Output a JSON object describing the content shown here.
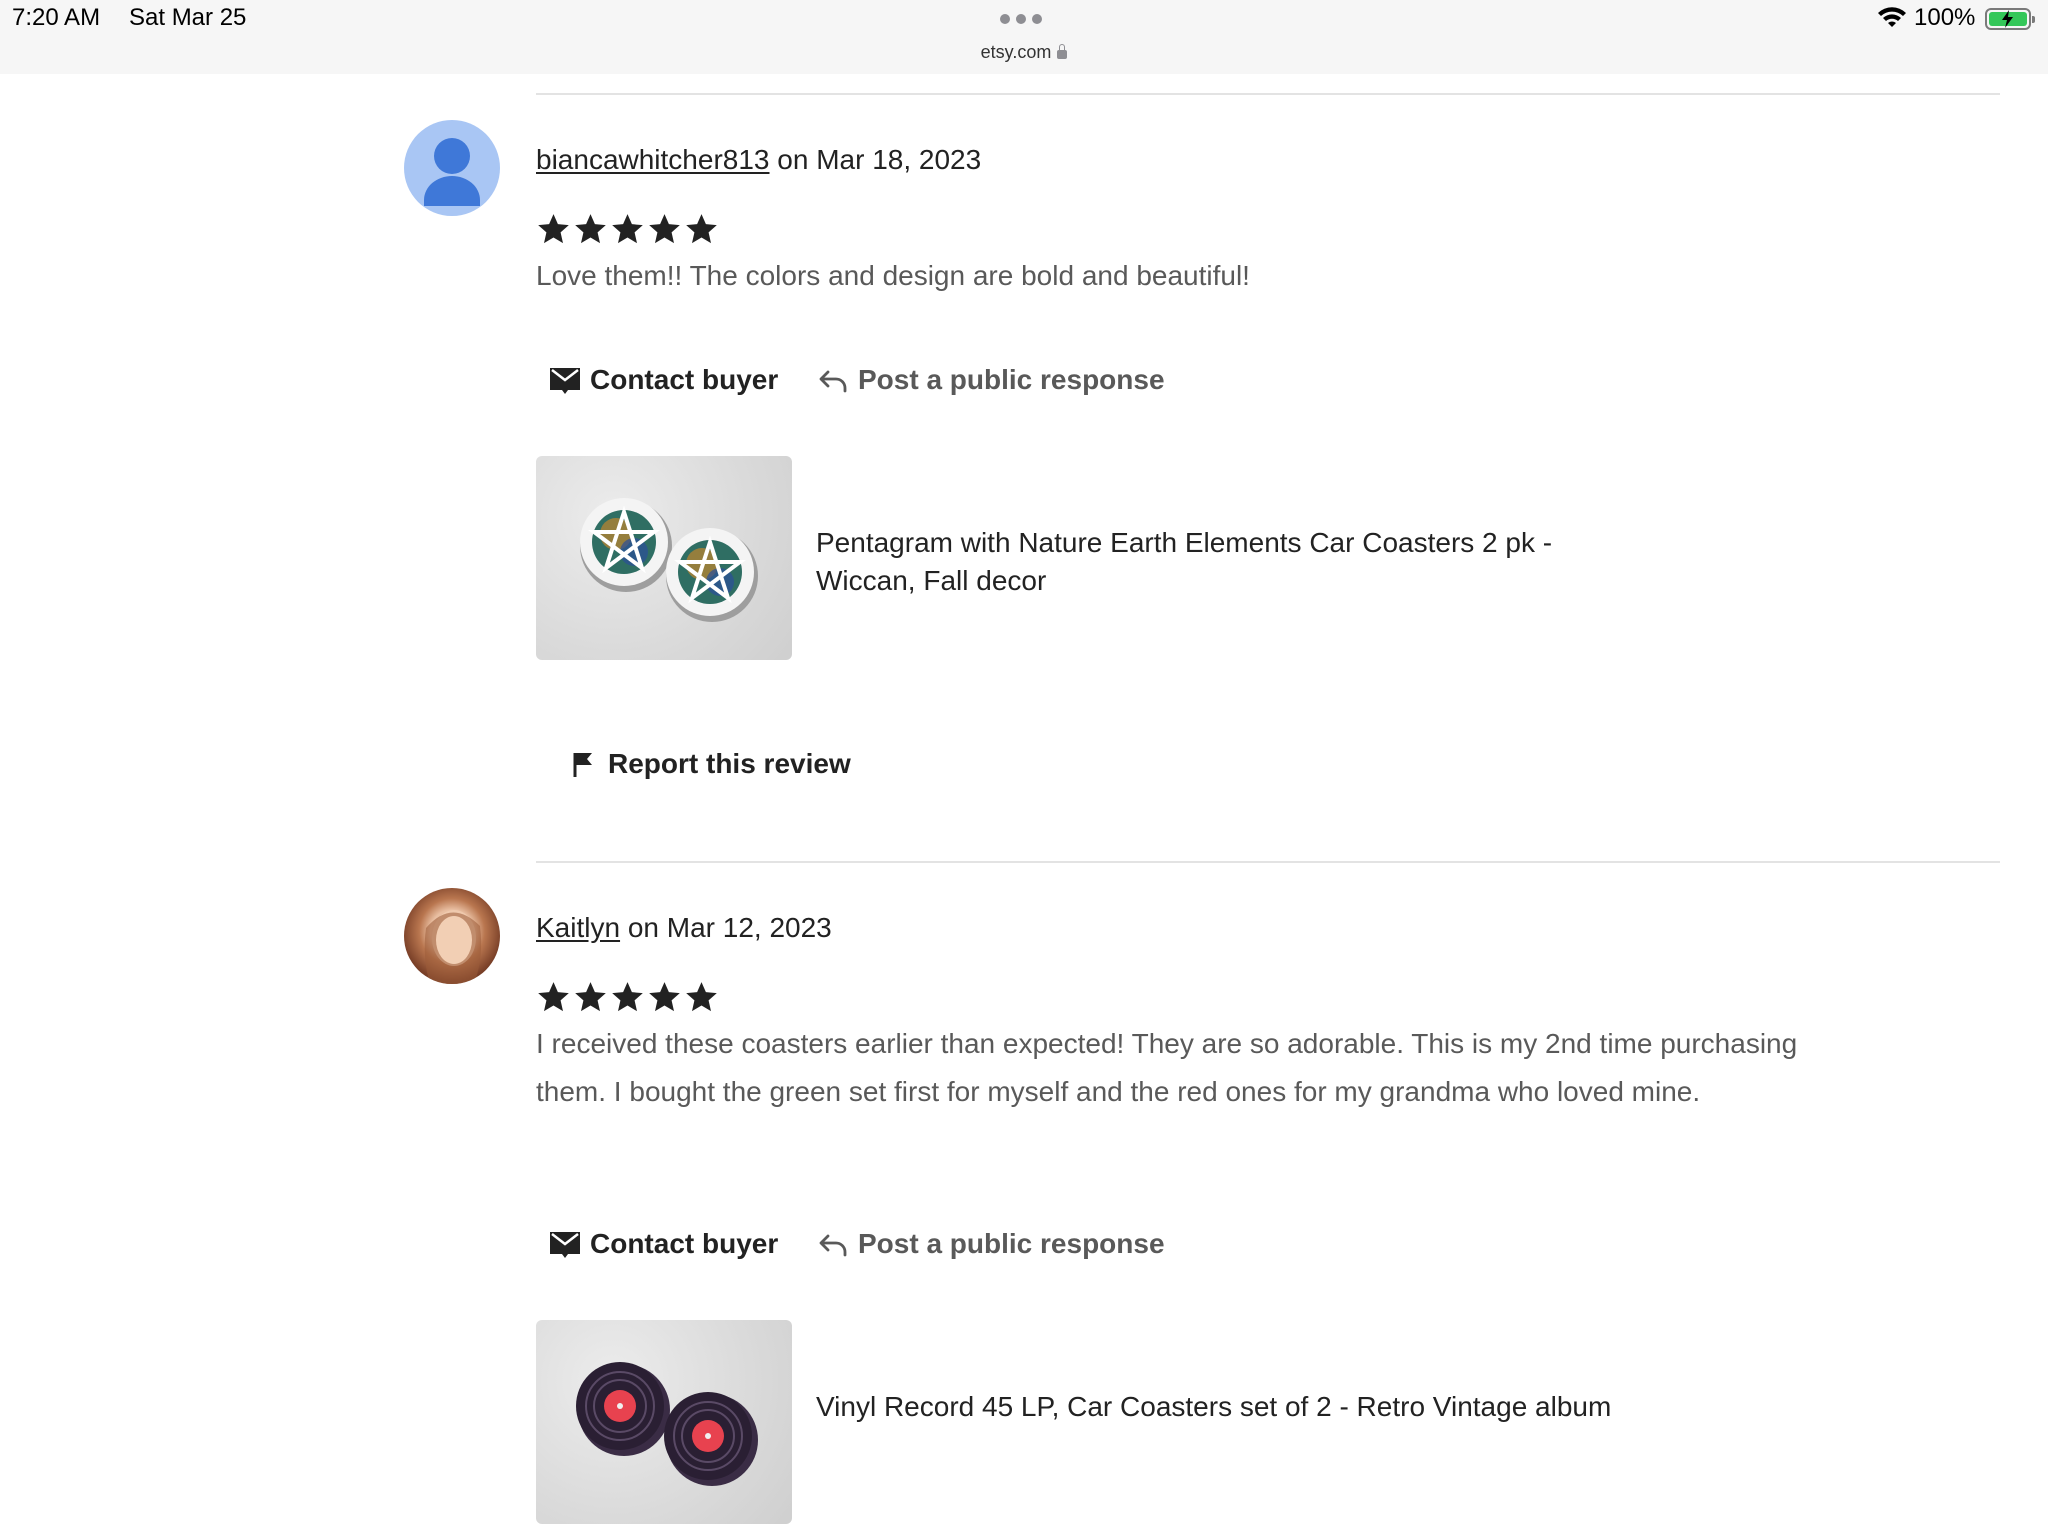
{
  "status_bar": {
    "time": "7:20 AM",
    "date": "Sat Mar 25",
    "battery": "100%",
    "url": "etsy.com"
  },
  "reviews": [
    {
      "username": "biancawhitcher813",
      "date_text": "on Mar 18, 2023",
      "rating": 5,
      "text": "Love them!! The colors and design are bold and beautiful!",
      "contact_label": "Contact buyer",
      "respond_label": "Post a public response",
      "product_title": "Pentagram with Nature Earth Elements Car Coasters 2 pk - Wiccan, Fall decor",
      "report_label": "Report this review"
    },
    {
      "username": "Kaitlyn",
      "date_text": "on Mar 12, 2023",
      "rating": 5,
      "text": "I received these coasters earlier than expected! They are so adorable. This is my 2nd time purchasing them. I bought the green set first for myself and the red ones for my grandma who loved mine.",
      "contact_label": "Contact buyer",
      "respond_label": "Post a public response",
      "product_title": "Vinyl Record 45 LP, Car Coasters set of 2 - Retro Vintage album"
    }
  ],
  "colors": {
    "text_primary": "#222222",
    "text_secondary": "#595959",
    "star": "#222222",
    "avatar_generic": "#a9c6f4",
    "avatar_figure": "#3f78d8",
    "battery_green": "#34c759"
  },
  "icons": [
    "wifi-icon",
    "battery-icon",
    "lock-icon",
    "envelope-icon",
    "reply-arrow-icon",
    "flag-icon",
    "star-icon"
  ]
}
